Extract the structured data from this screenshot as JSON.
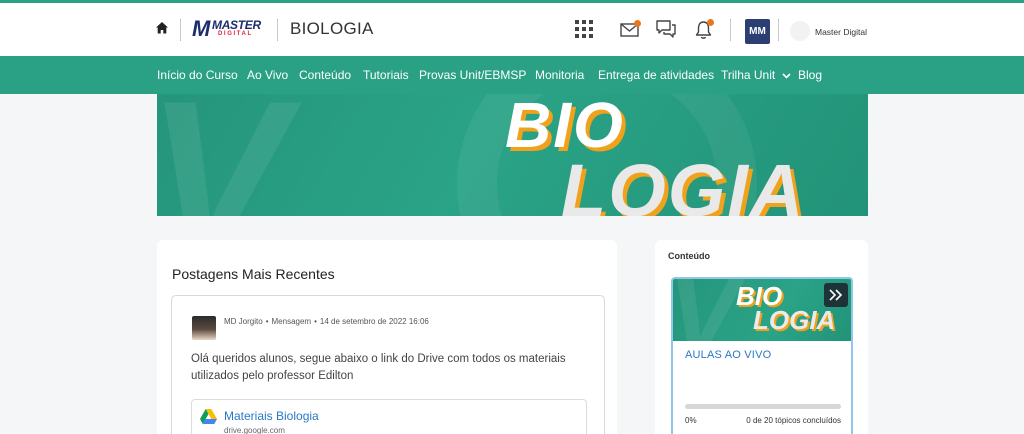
{
  "header": {
    "logo_word": "MASTER",
    "logo_sub": "DIGITAL",
    "course_title": "BIOLOGIA",
    "icons": [
      "home-icon",
      "grid-icon",
      "mail-icon",
      "chat-icon",
      "bell-icon"
    ],
    "avatar_initials": "MM",
    "user_name": "Master Digital",
    "notification_color": "#e87722"
  },
  "nav": {
    "items": [
      {
        "label": "Início do Curso"
      },
      {
        "label": "Ao Vivo"
      },
      {
        "label": "Conteúdo"
      },
      {
        "label": "Tutoriais"
      },
      {
        "label": "Provas Unit/EBMSP"
      },
      {
        "label": "Monitoria"
      },
      {
        "label": "Entrega de atividades"
      },
      {
        "label": "Trilha Unit"
      },
      {
        "label": "Blog"
      }
    ],
    "accent": "#2aa084"
  },
  "banner": {
    "line1": "BIO",
    "line2": "LOGIA"
  },
  "posts": {
    "title": "Postagens Mais Recentes",
    "items": [
      {
        "author": "MD Jorgito",
        "type": "Mensagem",
        "date": "14 de setembro de 2022 16:06",
        "body": "Olá queridos alunos, segue abaixo o link do Drive com todos os materiais utilizados pelo professor Edilton",
        "attachment_title": "Materiais Biologia",
        "attachment_url": "drive.google.com"
      }
    ]
  },
  "content": {
    "title": "Conteúdo",
    "module": {
      "thumb_line1": "BIO",
      "thumb_line2": "LOGIA",
      "title": "AULAS AO VIVO",
      "progress": 0,
      "progress_label": "0%",
      "topics_label": "0 de 20 tópicos concluídos"
    }
  }
}
